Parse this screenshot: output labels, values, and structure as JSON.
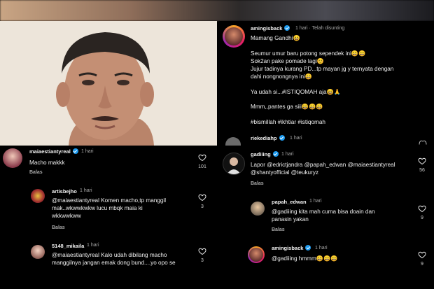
{
  "left": {
    "comments": [
      {
        "user": "maiaestiantyreal",
        "time": "1 hari",
        "lines": [
          "Macho makkk"
        ],
        "reply": "Balas",
        "likes": "101"
      },
      {
        "user": "artisbejho",
        "time": "1 hari",
        "lines": [
          "@maiaestiantyreal Komen macho,tp manggil",
          "mak..wkwwkwkw lucu mbqk maia ki",
          "wkkwwkww"
        ],
        "reply": "Balas",
        "likes": "3"
      },
      {
        "user": "5148_mikaila",
        "time": "1 hari",
        "lines": [
          "@maiaestiantyreal Kalo udah dibilang macho",
          "manggilnya jangan emak dong bund....yo opo se"
        ],
        "likes": "3"
      }
    ]
  },
  "right": {
    "post": {
      "user": "amingisback",
      "time": "1 hari",
      "edited": "· Telah disunting",
      "lines": [
        "Mamang Gandhi😄",
        "",
        "Seumur umur baru potong sependek ini😄😄",
        "Sok2an pake pomade lagi😊",
        "Jujur tadinya kurang PD...tp mayan jg y ternyata dengan",
        "dahi nongnongnya ini😄",
        "",
        "Ya udah si...#ISTIQOMAH aja😄🙏",
        "",
        "Mmm,,pantes ga siii😄😄😄",
        "",
        "#bismillah #ikhtiar #istiqomah"
      ]
    },
    "liker": {
      "user": "riekediahp",
      "time": "1 hari"
    },
    "comments": [
      {
        "user": "gadiiing",
        "time": "1 hari",
        "lines": [
          "Lapor @edrictjandra @papah_edwan @maiaestiantyreal",
          "@shantyofficial @teukuryz"
        ],
        "reply": "Balas",
        "likes": "56"
      },
      {
        "user": "papah_edwan",
        "time": "1 hari",
        "lines": [
          "@gadiiing kita mah cuma bisa doain dan",
          "panasin yakan"
        ],
        "reply": "Balas",
        "likes": "9"
      },
      {
        "user": "amingisback",
        "time": "1 hari",
        "lines": [
          "@gadiiing hmmm😄😄😄"
        ],
        "likes": "9"
      }
    ]
  },
  "icons": [
    "heart-icon",
    "verified-badge-icon"
  ]
}
